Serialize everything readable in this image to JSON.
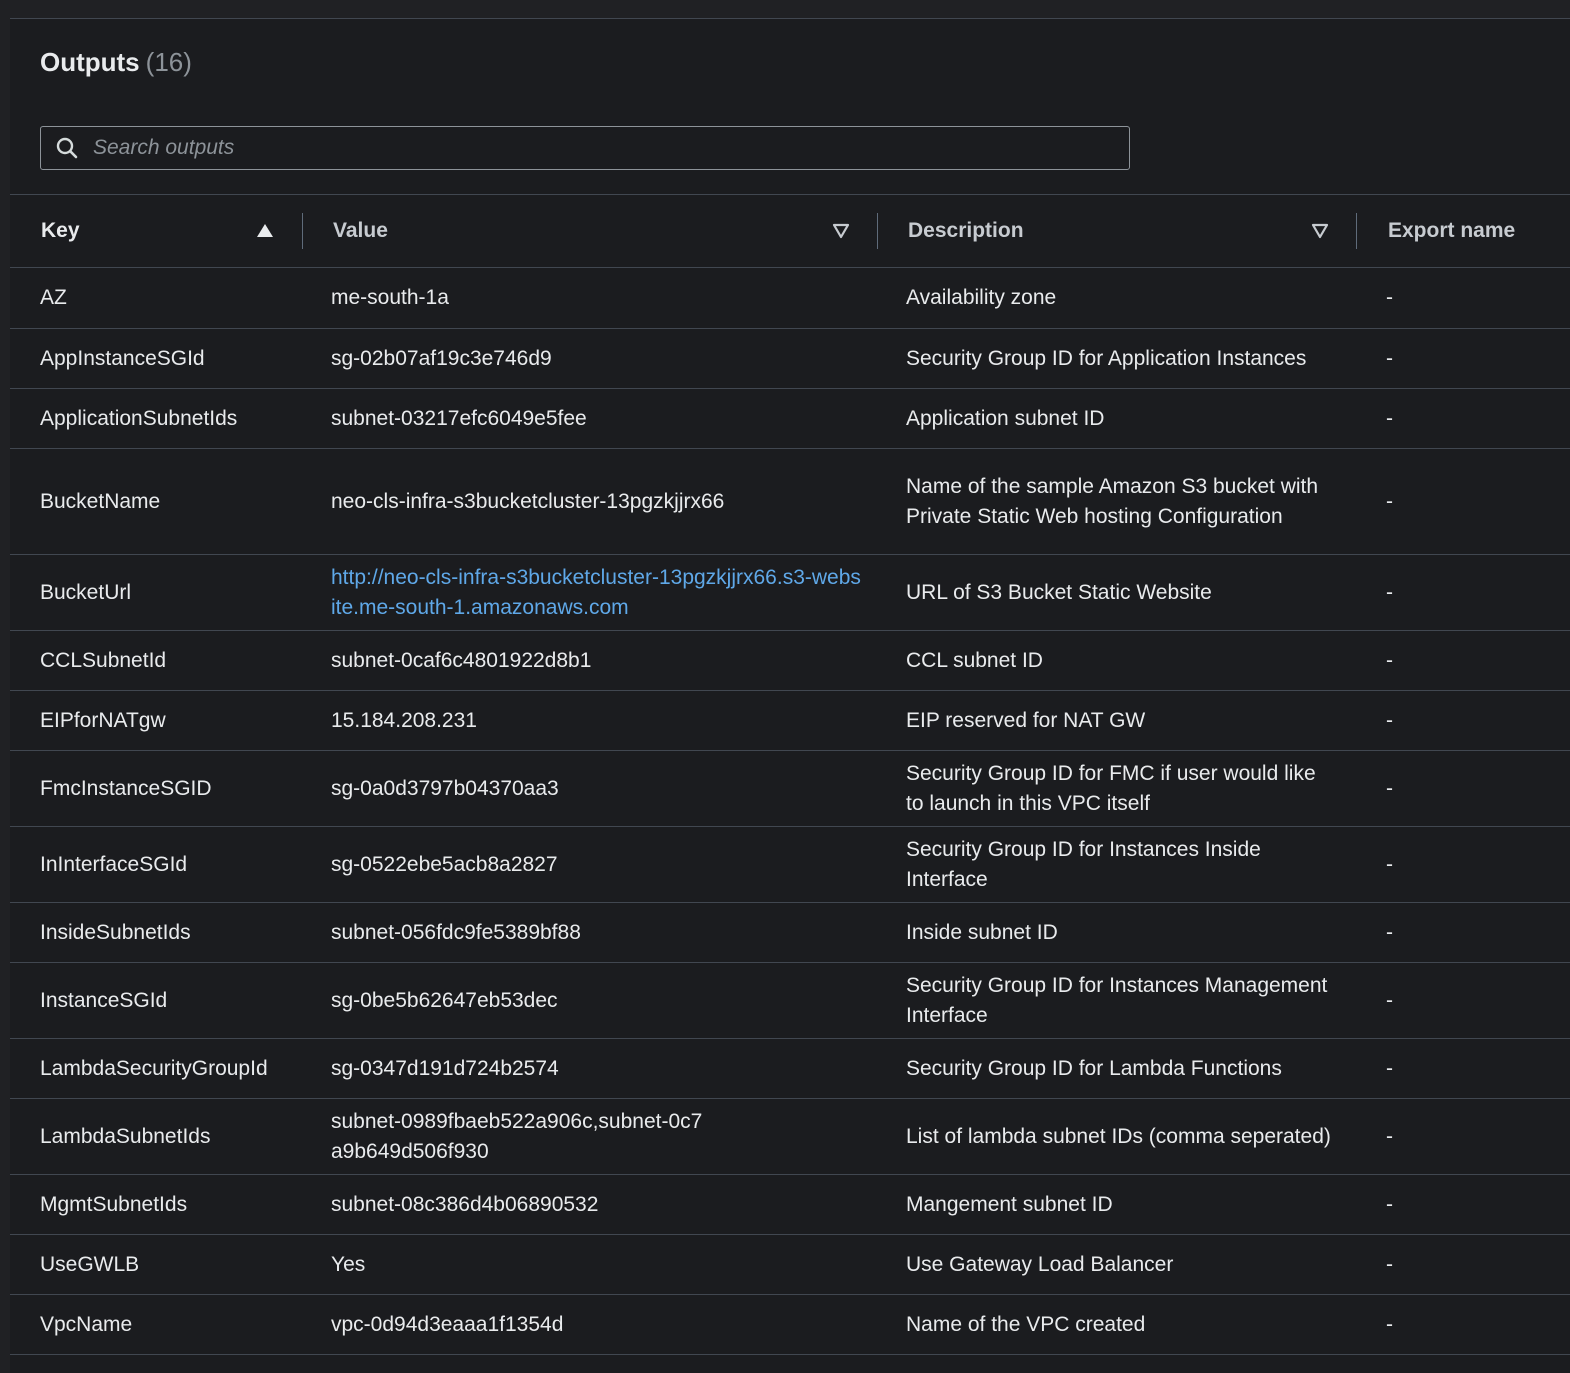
{
  "header": {
    "title": "Outputs",
    "count": "(16)"
  },
  "search": {
    "placeholder": "Search outputs",
    "value": ""
  },
  "table": {
    "columns": [
      {
        "label": "Key",
        "sort": "ascending"
      },
      {
        "label": "Value",
        "sort": "sortable"
      },
      {
        "label": "Description",
        "sort": "sortable"
      },
      {
        "label": "Export name"
      }
    ],
    "rows": [
      {
        "key": "AZ",
        "value": "me-south-1a",
        "description": "Availability zone",
        "export": "-"
      },
      {
        "key": "AppInstanceSGId",
        "value": "sg-02b07af19c3e746d9",
        "description": "Security Group ID for Application Instances",
        "export": "-"
      },
      {
        "key": "ApplicationSubnetIds",
        "value": "subnet-03217efc6049e5fee",
        "description": "Application subnet ID",
        "export": "-"
      },
      {
        "key": "BucketName",
        "value": "neo-cls-infra-s3bucketcluster-13pgzkjjrx66",
        "description": "Name of the sample Amazon S3 bucket with Private Static Web hosting Configuration",
        "export": "-"
      },
      {
        "key": "BucketUrl",
        "value": "http://neo-cls-infra-s3bucketcluster-13pgzkjjrx66.s3-website.me-south-1.amazonaws.com",
        "description": "URL of S3 Bucket Static Website",
        "export": "-",
        "is_link": true
      },
      {
        "key": "CCLSubnetId",
        "value": "subnet-0caf6c4801922d8b1",
        "description": "CCL subnet ID",
        "export": "-"
      },
      {
        "key": "EIPforNATgw",
        "value": "15.184.208.231",
        "description": "EIP reserved for NAT GW",
        "export": "-"
      },
      {
        "key": "FmcInstanceSGID",
        "value": "sg-0a0d3797b04370aa3",
        "description": "Security Group ID for FMC if user would like to launch in this VPC itself",
        "export": "-"
      },
      {
        "key": "InInterfaceSGId",
        "value": "sg-0522ebe5acb8a2827",
        "description": "Security Group ID for Instances Inside Interface",
        "export": "-"
      },
      {
        "key": "InsideSubnetIds",
        "value": "subnet-056fdc9fe5389bf88",
        "description": "Inside subnet ID",
        "export": "-"
      },
      {
        "key": "InstanceSGId",
        "value": "sg-0be5b62647eb53dec",
        "description": "Security Group ID for Instances Management Interface",
        "export": "-"
      },
      {
        "key": "LambdaSecurityGroupId",
        "value": "sg-0347d191d724b2574",
        "description": "Security Group ID for Lambda Functions",
        "export": "-"
      },
      {
        "key": "LambdaSubnetIds",
        "value": "subnet-0989fbaeb522a906c,subnet-0c7a9b649d506f930",
        "description": "List of lambda subnet IDs (comma seperated)",
        "export": "-"
      },
      {
        "key": "MgmtSubnetIds",
        "value": "subnet-08c386d4b06890532",
        "description": "Mangement subnet ID",
        "export": "-"
      },
      {
        "key": "UseGWLB",
        "value": "Yes",
        "description": "Use Gateway Load Balancer",
        "export": "-"
      },
      {
        "key": "VpcName",
        "value": "vpc-0d94d3eaaa1f1354d",
        "description": "Name of the VPC created",
        "export": "-"
      }
    ]
  },
  "icons": {
    "search": "search-icon",
    "sort_asc": "sort-ascending-icon",
    "sort_none": "sort-descending-outline-icon"
  },
  "colors": {
    "background": "#1b1c1f",
    "text": "#e9ebed",
    "link": "#5fa8e8",
    "border": "#414750"
  }
}
